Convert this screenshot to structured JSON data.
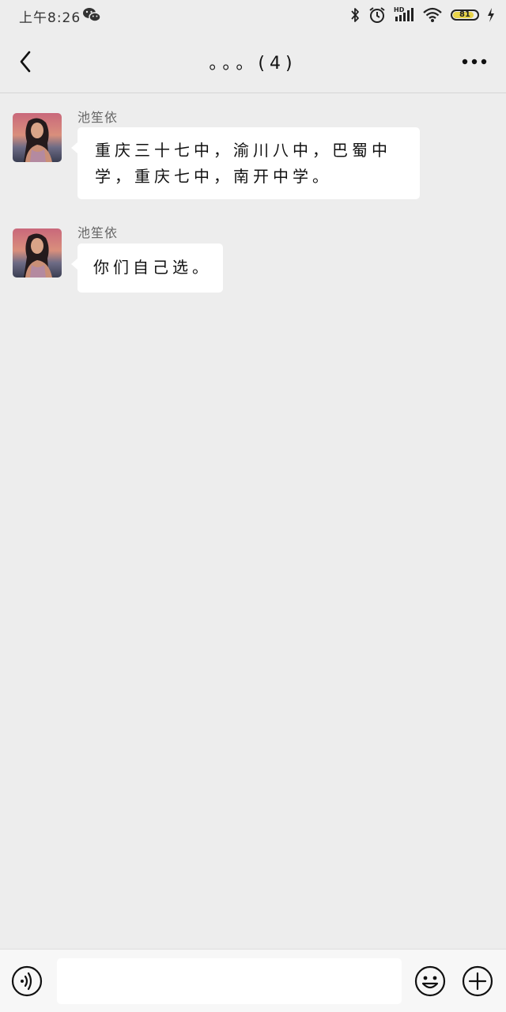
{
  "status_bar": {
    "time": "上午8:26",
    "battery_level": "81",
    "network_badge": "HD",
    "icons": [
      "wechat-icon",
      "bluetooth-icon",
      "alarm-icon",
      "signal-icon",
      "wifi-icon",
      "battery-icon",
      "charging-icon"
    ]
  },
  "nav": {
    "title": "。。。(4)",
    "icons": [
      "back-chevron-icon",
      "more-dots-icon"
    ]
  },
  "messages": [
    {
      "sender": "池笙依",
      "line1": "重庆三十七中，渝川八中，巴蜀中",
      "line2": "学，重庆七中，南开中学。"
    },
    {
      "sender": "池笙依",
      "line1": "你们自己选。"
    }
  ],
  "input_bar": {
    "placeholder": "",
    "icons": [
      "voice-icon",
      "emoji-icon",
      "plus-icon"
    ]
  },
  "colors": {
    "background": "#ededed",
    "bubble": "#ffffff",
    "text": "#111111",
    "battery_fill": "#e8d44a"
  }
}
